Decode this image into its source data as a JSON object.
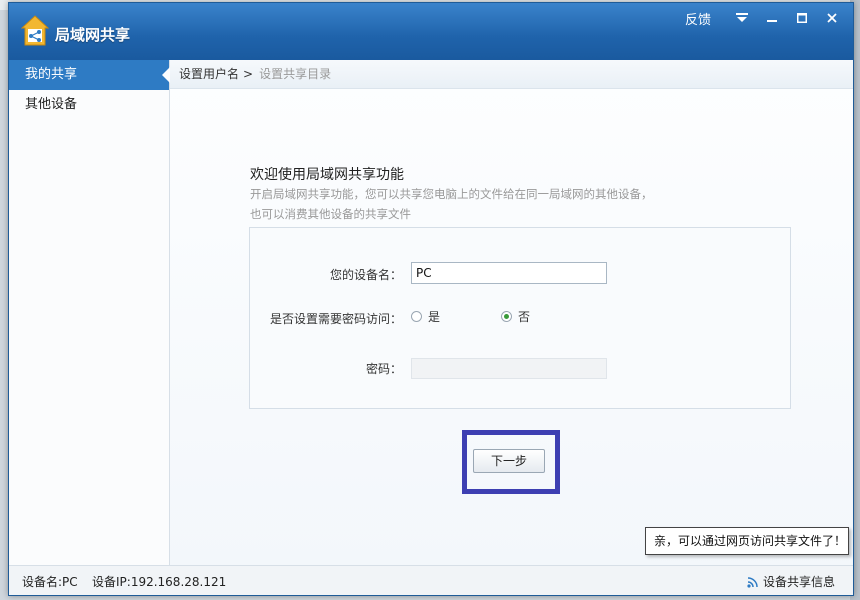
{
  "app": {
    "title": "局域网共享",
    "feedback": "反馈"
  },
  "sidebar": {
    "items": [
      {
        "label": "我的共享",
        "active": true
      },
      {
        "label": "其他设备",
        "active": false
      }
    ]
  },
  "breadcrumb": {
    "current": "设置用户名",
    "separator": ">",
    "next": "设置共享目录"
  },
  "welcome": {
    "heading": "欢迎使用局域网共享功能",
    "desc_line1": "开启局域网共享功能，您可以共享您电脑上的文件给在同一局域网的其他设备，",
    "desc_line2": "也可以消费其他设备的共享文件"
  },
  "form": {
    "device_name_label": "您的设备名：",
    "device_name_value": "PC",
    "password_required_label": "是否设置需要密码访问：",
    "option_yes": "是",
    "option_no": "否",
    "selected": "否",
    "password_label": "密码："
  },
  "next_button": "下一步",
  "tooltip": "亲，可以通过网页访问共享文件了！",
  "status": {
    "device_name": "设备名:PC",
    "device_ip": "设备IP:192.168.28.121",
    "share_info": "设备共享信息"
  },
  "colors": {
    "titlebar": "#1f63ab",
    "sidebar_active": "#2e7bc4",
    "highlight_box": "#3d3fb2",
    "radio_selected": "#3a9a3a"
  }
}
